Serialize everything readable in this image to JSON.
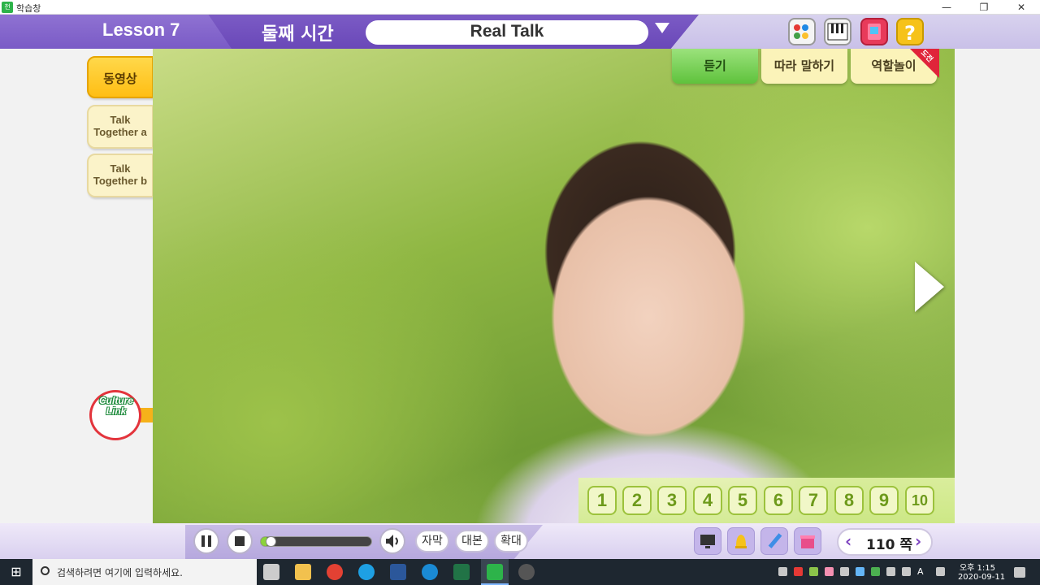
{
  "window": {
    "app_icon_text": "천재",
    "title": "학습창",
    "minimize": "—",
    "maximize": "❐",
    "close": "✕"
  },
  "header": {
    "lesson": "Lesson 7",
    "section": "둘째 시간",
    "topic": "Real Talk",
    "tools": [
      "palette-icon",
      "piano-icon",
      "book-icon",
      "question-icon"
    ],
    "tool_colors": [
      "#f4f4f4",
      "#f4f4f4",
      "#e83a5a",
      "#f6c21a"
    ]
  },
  "sidebar": {
    "tabs": [
      {
        "line1": "동영상"
      },
      {
        "line1": "Talk",
        "line2": "Together a"
      },
      {
        "line1": "Talk",
        "line2": "Together b"
      }
    ],
    "culture_link": {
      "line1": "Culture",
      "line2": "Link"
    }
  },
  "modes": {
    "listen": "듣기",
    "repeat": "따라 말하기",
    "role": "역할놀이",
    "challenge": "도전"
  },
  "scenes": [
    "1",
    "2",
    "3",
    "4",
    "5",
    "6",
    "7",
    "8",
    "9",
    "10"
  ],
  "controls": {
    "progress": 0.08,
    "subtitle": "자막",
    "script": "대본",
    "zoom": "확대",
    "page": "110 쪽",
    "prev": "‹",
    "next": "›",
    "tools": [
      "monitor-icon",
      "bell-icon",
      "pen-icon",
      "box-icon"
    ]
  },
  "taskbar": {
    "search_placeholder": "검색하려면 여기에 입력하세요.",
    "time": "오후 1:15",
    "date": "2020-09-11",
    "apps": [
      "task-view-icon",
      "file-explorer-icon",
      "chrome-icon",
      "ie-icon",
      "word-icon",
      "edge-icon",
      "excel-icon",
      "cheonjae-icon",
      "obs-icon"
    ],
    "app_colors": [
      "#cccccc",
      "#f2c14e",
      "#e34133",
      "#1ea0e3",
      "#2b579a",
      "#1a8ad4",
      "#217346",
      "#2db34a",
      "#555555"
    ]
  },
  "colors": {
    "accent": "#7a5bc6",
    "active_mode": "#5fc23c",
    "video_tab": "#ffbe14"
  }
}
